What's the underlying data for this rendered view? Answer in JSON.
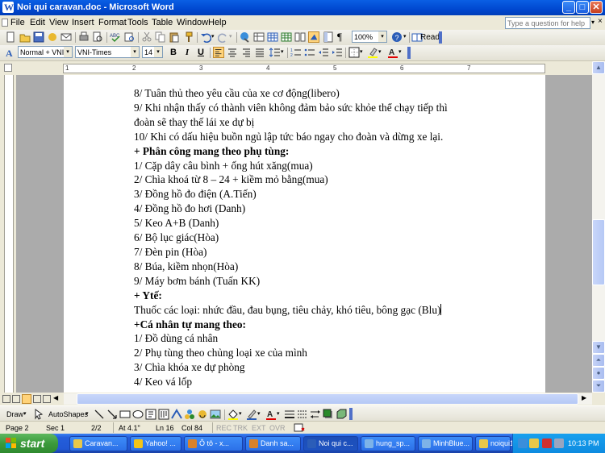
{
  "window": {
    "title": "Noi qui caravan.doc - Microsoft Word",
    "controls": [
      "minimize-icon",
      "maximize-icon",
      "close-icon"
    ]
  },
  "menu": {
    "items": [
      "File",
      "Edit",
      "View",
      "Insert",
      "Format",
      "Tools",
      "Table",
      "Window",
      "Help"
    ],
    "ask_placeholder": "Type a question for help"
  },
  "toolbar": {
    "zoom": "100%",
    "read_label": "Read",
    "style": "Normal + VNI-T",
    "font": "VNI-Times",
    "size": "14",
    "bold": "B",
    "italic": "I",
    "underline": "U"
  },
  "ruler_numbers": [
    "1",
    "2",
    "3",
    "4",
    "5",
    "6",
    "7"
  ],
  "document": {
    "lines": [
      {
        "text": "8/ Tuân thủ theo yêu cầu của xe cơ động(libero)",
        "bold": false
      },
      {
        "text": "9/ Khi nhận thấy có thành viên không đảm bảo sức khỏe thể chạy tiếp thì",
        "bold": false
      },
      {
        "text": "đoàn sẽ thay thế lái xe dự bị",
        "bold": false
      },
      {
        "text": "10/ Khi có dấu hiệu buồn ngủ lập tức báo ngay cho đoàn và dừng xe lại.",
        "bold": false
      },
      {
        "text": "+ Phân công mang theo phụ tùng:",
        "bold": true
      },
      {
        "text": "1/ Cặp dây câu bình + ống hút xăng(mua)",
        "bold": false
      },
      {
        "text": "2/ Chìa khoá từ 8 – 24 + kiềm mỏ bằng(mua)",
        "bold": false
      },
      {
        "text": "3/ Đồng hồ đo điện (A.Tiến)",
        "bold": false
      },
      {
        "text": "4/ Đồng hồ đo hơi (Danh)",
        "bold": false
      },
      {
        "text": "5/ Keo A+B (Danh)",
        "bold": false
      },
      {
        "text": "6/ Bộ lục giác(Hòa)",
        "bold": false
      },
      {
        "text": "7/ Đèn pin (Hòa)",
        "bold": false
      },
      {
        "text": "8/ Búa, kiềm nhọn(Hòa)",
        "bold": false
      },
      {
        "text": "9/ Máy bơm bánh (Tuấn KK)",
        "bold": false
      },
      {
        "text": "+ Ytế:",
        "bold": true
      },
      {
        "text": "Thuốc các loại: nhức đầu, đau bụng, tiêu chảy, khó tiêu, bông gạc (Blu)",
        "bold": false,
        "cursor": true
      },
      {
        "text": "+Cá nhân tự mang theo:",
        "bold": true
      },
      {
        "text": "1/ Đồ dùng cá nhân",
        "bold": false
      },
      {
        "text": "2/ Phụ tùng theo chủng loại xe của mình",
        "bold": false
      },
      {
        "text": "3/ Chìa khóa xe dự phòng",
        "bold": false
      },
      {
        "text": "4/ Keo vá lốp",
        "bold": false
      }
    ]
  },
  "draw_toolbar": {
    "draw_label": "Draw",
    "autoshapes_label": "AutoShapes"
  },
  "status": {
    "page": "Page 2",
    "sec": "Sec 1",
    "pages": "2/2",
    "at": "At 4.1\"",
    "ln": "Ln 16",
    "col": "Col 84",
    "rec": "REC",
    "trk": "TRK",
    "ext": "EXT",
    "ovr": "OVR"
  },
  "taskbar": {
    "start_label": "start",
    "tasks": [
      {
        "label": "Caravan...",
        "color": "#E8C84A"
      },
      {
        "label": "Yahoo! ...",
        "color": "#F2C418"
      },
      {
        "label": "Ô tô - x...",
        "color": "#D9822B"
      },
      {
        "label": "Danh sa...",
        "color": "#D9822B"
      },
      {
        "label": "Noi qui c...",
        "color": "#2B5DB8",
        "active": true
      },
      {
        "label": "hung_sp...",
        "color": "#7DB3E8"
      },
      {
        "label": "MinhBlue...",
        "color": "#7DB3E8"
      },
      {
        "label": "noiqui1....",
        "color": "#E8C84A"
      }
    ],
    "clock": "10:13 PM"
  },
  "colors": {
    "titlebar": "#0A5FE4",
    "taskbar": "#245EDB",
    "start": "#3C9A3C",
    "font_color": "#E00000",
    "highlight": "#FFFF00"
  }
}
